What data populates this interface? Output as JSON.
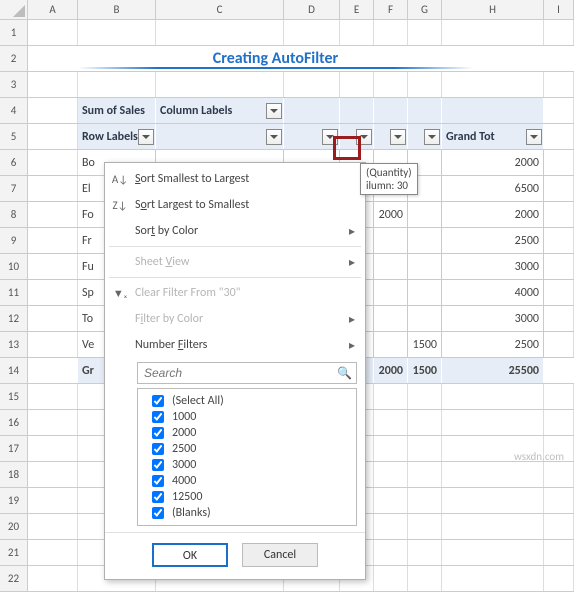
{
  "columns": [
    "A",
    "B",
    "C",
    "D",
    "E",
    "F",
    "G",
    "H",
    "I"
  ],
  "row_numbers": [
    1,
    2,
    3,
    4,
    5,
    6,
    7,
    8,
    9,
    10,
    11,
    12,
    13,
    14,
    15,
    16,
    17,
    18,
    19,
    20,
    21,
    22
  ],
  "title": "Creating AutoFilter",
  "pivot": {
    "measure_label": "Sum of Sales",
    "col_field_label": "Column Labels",
    "row_field_label": "Row Labels",
    "grand_total_label": "Grand Tot",
    "rows": [
      {
        "label": "Bo",
        "cols": [
          "",
          "",
          "",
          "",
          ""
        ],
        "total": "2000"
      },
      {
        "label": "El",
        "cols": [
          "",
          "",
          "",
          "",
          ""
        ],
        "total": "6500"
      },
      {
        "label": "Fo",
        "cols": [
          "",
          "",
          "2000",
          "",
          ""
        ],
        "total": "2000"
      },
      {
        "label": "Fr",
        "cols": [
          "",
          "",
          "",
          "",
          ""
        ],
        "total": "2500"
      },
      {
        "label": "Fu",
        "cols": [
          "",
          "",
          "",
          "",
          ""
        ],
        "total": "3000"
      },
      {
        "label": "Sp",
        "cols": [
          "",
          "",
          "",
          "",
          ""
        ],
        "total": "4000"
      },
      {
        "label": "To",
        "cols": [
          "",
          "",
          "",
          "",
          ""
        ],
        "total": "3000"
      },
      {
        "label": "Ve",
        "cols": [
          "",
          "",
          "",
          "1500",
          ""
        ],
        "total": "2500"
      }
    ],
    "grand_row_label": "Gr",
    "grand_cols": [
      "",
      "",
      "2000",
      "1500",
      ""
    ],
    "grand_total": "25500"
  },
  "active_column_tooltip": {
    "line1": "(Quantity)",
    "line2": "ilumn: 30"
  },
  "menu": {
    "sort_asc": "Sort Smallest to Largest",
    "sort_desc": "Sort Largest to Smallest",
    "sort_color": "Sort by Color",
    "sheet_view": "Sheet View",
    "clear_filter": "Clear Filter From \"30\"",
    "filter_color": "Filter by Color",
    "number_filters": "Number Filters",
    "search_placeholder": "Search",
    "items": [
      "(Select All)",
      "1000",
      "2000",
      "2500",
      "3000",
      "4000",
      "12500",
      "(Blanks)"
    ],
    "ok": "OK",
    "cancel": "Cancel"
  },
  "watermark": "wsxdn.com"
}
